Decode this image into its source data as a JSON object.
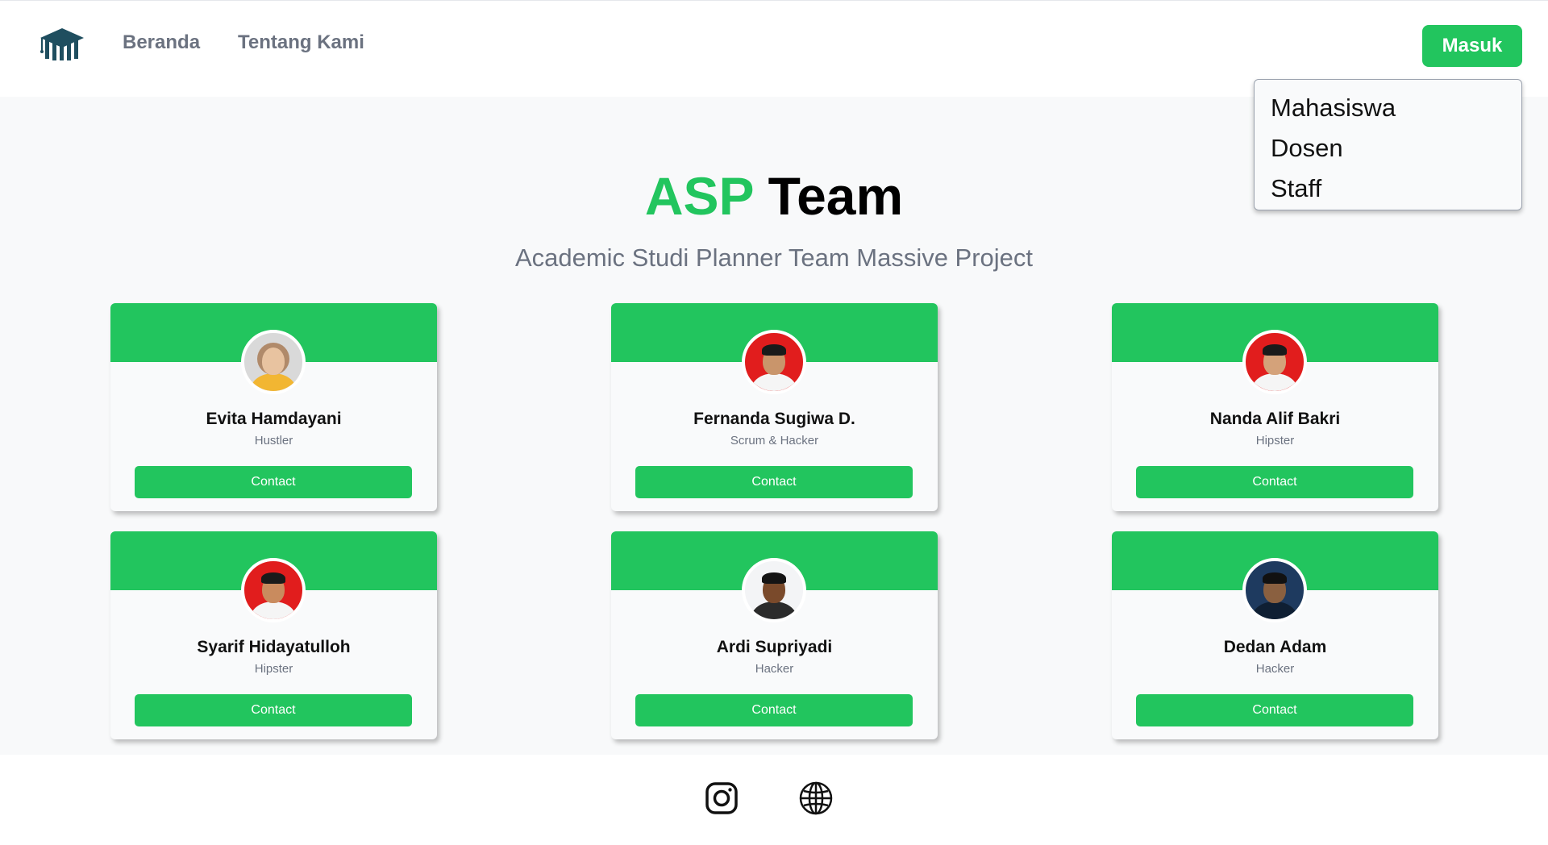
{
  "nav": {
    "links": [
      "Beranda",
      "Tentang Kami"
    ],
    "login_label": "Masuk",
    "logo_icon": "university-logo-icon"
  },
  "dropdown": {
    "items": [
      "Mahasiswa",
      "Dosen",
      "Staff"
    ]
  },
  "hero": {
    "title_accent": "ASP",
    "title_rest": "Team",
    "subtitle": "Academic Studi Planner Team Massive Project"
  },
  "colors": {
    "accent": "#22c55e",
    "muted_text": "#6b7280",
    "page_bg": "#f8f9fa"
  },
  "team": [
    {
      "name": "Evita Hamdayani",
      "role": "Hustler",
      "contact_label": "Contact",
      "photo_bg": "#d9d9d9"
    },
    {
      "name": "Fernanda Sugiwa D.",
      "role": "Scrum & Hacker",
      "contact_label": "Contact",
      "photo_bg": "#e11d1d"
    },
    {
      "name": "Nanda Alif Bakri",
      "role": "Hipster",
      "contact_label": "Contact",
      "photo_bg": "#e11d1d"
    },
    {
      "name": "Syarif Hidayatulloh",
      "role": "Hipster",
      "contact_label": "Contact",
      "photo_bg": "#e11d1d"
    },
    {
      "name": "Ardi Supriyadi",
      "role": "Hacker",
      "contact_label": "Contact",
      "photo_bg": "#f3f4f6"
    },
    {
      "name": "Dedan Adam",
      "role": "Hacker",
      "contact_label": "Contact",
      "photo_bg": "#1e3a5f"
    }
  ],
  "footer": {
    "icons": [
      "instagram-icon",
      "globe-icon"
    ]
  }
}
